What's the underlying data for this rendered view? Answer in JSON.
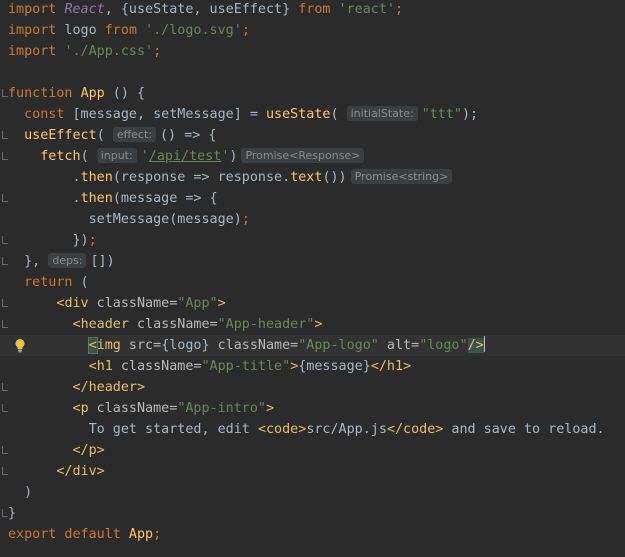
{
  "code": {
    "imports": {
      "l1": {
        "kw": "import",
        "react": "React",
        "rest": ", {useState, useEffect} ",
        "from": "from",
        "src": "'react'",
        "semi": ";"
      },
      "l2": {
        "kw": "import",
        "rest": " logo ",
        "from": "from",
        "src": "'./logo.svg'",
        "semi": ";"
      },
      "l3": {
        "kw": "import",
        "src": "'./App.css'",
        "semi": ";"
      }
    },
    "fn_decl": {
      "kw": "function",
      "name": "App",
      "rest": " () {"
    },
    "state_line": {
      "kw": "const",
      "rest": " [message, setMessage] = ",
      "fn": "useState",
      "open": "(",
      "hint": "initialState:",
      "str": "\"ttt\"",
      "close": ");"
    },
    "effect_line": {
      "fn": "useEffect",
      "open": "(",
      "hint": "effect:",
      "rest": "() => {"
    },
    "fetch_line": {
      "fn": "fetch",
      "open": "(",
      "hint": "input:",
      "q1": "'",
      "url": "/api/test",
      "q2": "'",
      "close": ")",
      "type": "Promise<Response>"
    },
    "then1_line": {
      "dot": ".",
      "fn": "then",
      "rest": "(response => response.",
      "fn2": "text",
      "close": "())",
      "type": "Promise<string>"
    },
    "then2_line": {
      "dot": ".",
      "fn": "then",
      "rest": "(message => {"
    },
    "set_line": {
      "rest": "setMessage(message)",
      "semi": ";"
    },
    "close_then": {
      "rest": "})",
      "semi": ";"
    },
    "deps_line": {
      "pre": "}, ",
      "hint": "deps:",
      "rest": "[])"
    },
    "return_line": {
      "kw": "return",
      "rest": " ("
    },
    "jsx": {
      "div_open": {
        "lt": "<",
        "tag": "div",
        "attr": " className=",
        "val": "\"App\"",
        "gt": ">"
      },
      "header_open": {
        "lt": "<",
        "tag": "header",
        "attr": " className=",
        "val": "\"App-header\"",
        "gt": ">"
      },
      "img_line": {
        "lt": "<",
        "tag": "img",
        "attr1": " src=",
        "val1": "{logo}",
        "attr2": " className=",
        "val2": "\"App-logo\"",
        "attr3": " alt=",
        "val3": "\"logo\"",
        "end": "/>"
      },
      "h1_line": {
        "lt": "<",
        "tag": "h1",
        "attr": " className=",
        "val": "\"App-title\"",
        "gt": ">",
        "content": "{message}",
        "close": "</h1>"
      },
      "header_close": "</header>",
      "p_open": {
        "lt": "<",
        "tag": "p",
        "attr": " className=",
        "val": "\"App-intro\"",
        "gt": ">"
      },
      "intro_line": {
        "pre": "To get started, edit ",
        "code_open": "<code>",
        "path": "src/App.js",
        "code_close": "</code>",
        "post": " and save to reload."
      },
      "p_close": "</p>",
      "div_close": "</div>"
    },
    "paren_close": ")",
    "brace_close": "}",
    "export_line": {
      "kw1": "export",
      "kw2": " default",
      "rest": " App",
      "semi": ";"
    }
  },
  "colors": {
    "background": "#2b2b2b",
    "keyword": "#cc7832",
    "string": "#6a8759",
    "function": "#ffc66d",
    "tag": "#e8bf6a",
    "react": "#9876aa"
  },
  "icons": {
    "bulb": "lightbulb-icon"
  }
}
